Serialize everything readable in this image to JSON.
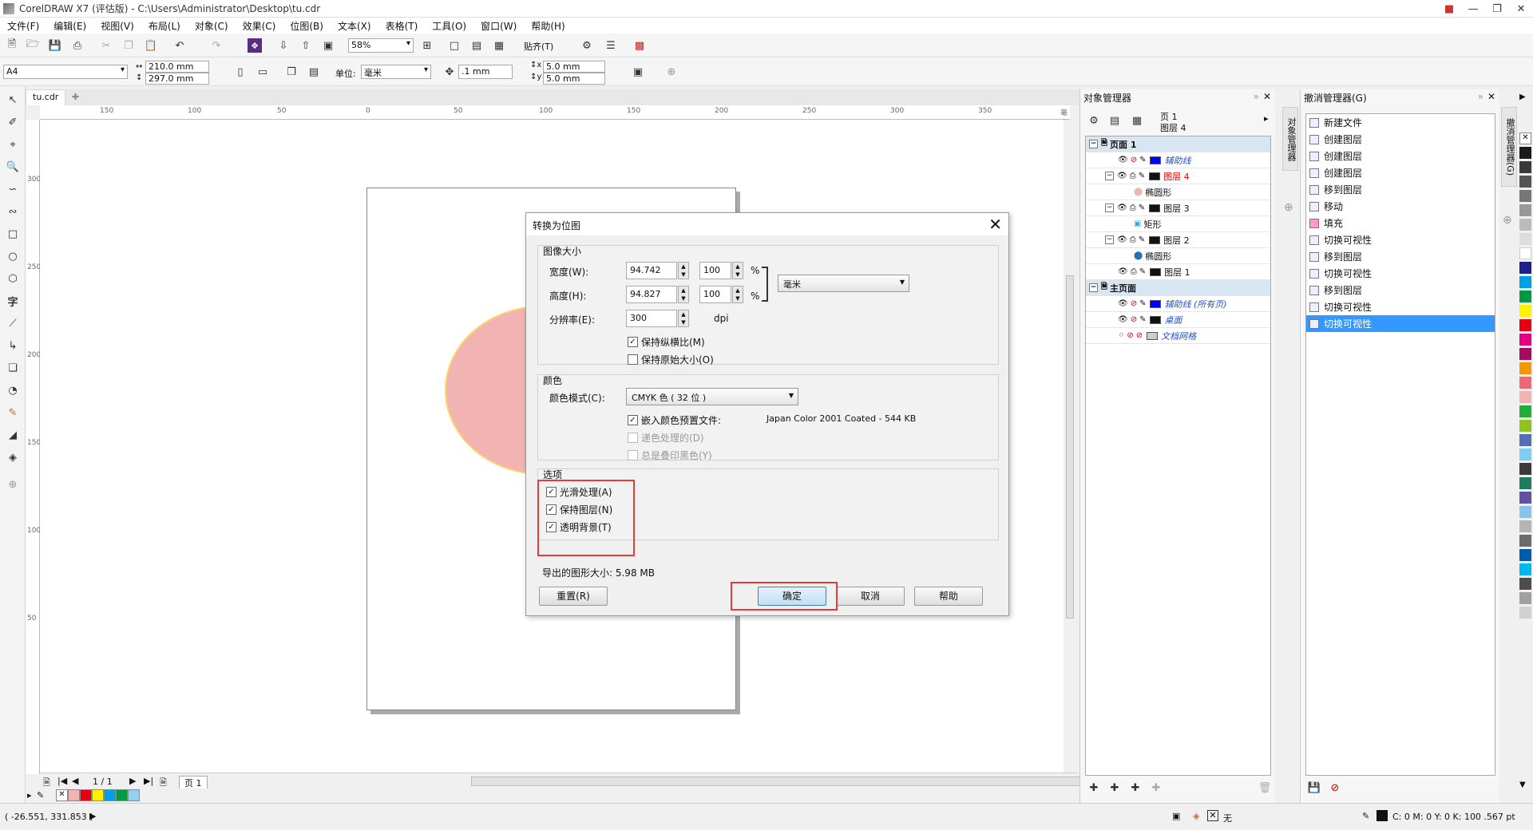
{
  "window": {
    "title": "CorelDRAW X7 (评估版) - C:\\Users\\Administrator\\Desktop\\tu.cdr"
  },
  "menu": [
    "文件(F)",
    "编辑(E)",
    "视图(V)",
    "布局(L)",
    "对象(C)",
    "效果(C)",
    "位图(B)",
    "文本(X)",
    "表格(T)",
    "工具(O)",
    "窗口(W)",
    "帮助(H)"
  ],
  "toolbar": {
    "zoom": "58%",
    "snap": "贴齐(T)"
  },
  "propbar": {
    "page_size": "A4",
    "width": "210.0 mm",
    "height": "297.0 mm",
    "units_label": "单位:",
    "units": "毫米",
    "nudge": ".1 mm",
    "dup_x": "5.0 mm",
    "dup_y": "5.0 mm"
  },
  "doc_tab": "tu.cdr",
  "ruler_h": [
    "150",
    "100",
    "50",
    "0",
    "50",
    "100",
    "150",
    "200",
    "250",
    "300",
    "350"
  ],
  "ruler_unit": "毫米",
  "ruler_v": [
    "300",
    "250",
    "200",
    "150",
    "100",
    "50"
  ],
  "page_nav": {
    "count": "1 / 1",
    "tab": "页 1"
  },
  "status": {
    "coords": "( -26.551, 331.853 )",
    "fill_none": "无",
    "outline": "C: 0 M: 0 Y: 0 K: 100  .567 pt"
  },
  "object_manager": {
    "title": "对象管理器",
    "current_page": "页 1",
    "current_layer": "图层 4",
    "rows": [
      {
        "label": "页面 1",
        "type": "page"
      },
      {
        "label": "辅助线",
        "type": "guide",
        "color": "#0000ff"
      },
      {
        "label": "图层 4",
        "type": "layer-active",
        "color": "#111111"
      },
      {
        "label": "椭圆形",
        "type": "child"
      },
      {
        "label": "图层 3",
        "type": "layer",
        "color": "#111111"
      },
      {
        "label": "矩形",
        "type": "child"
      },
      {
        "label": "图层 2",
        "type": "layer",
        "color": "#111111"
      },
      {
        "label": "椭圆形",
        "type": "child"
      },
      {
        "label": "图层 1",
        "type": "layer",
        "color": "#111111"
      },
      {
        "label": "主页面",
        "type": "page"
      },
      {
        "label": "辅助线 (所有页)",
        "type": "guide",
        "color": "#0000ff"
      },
      {
        "label": "桌面",
        "type": "guide",
        "color": "#111111"
      },
      {
        "label": "文档网格",
        "type": "guide",
        "color": "#cccccc"
      }
    ],
    "vertical_tab": "对象管理器"
  },
  "undo_manager": {
    "title": "撤消管理器(G)",
    "items": [
      "新建文件",
      "创建图层",
      "创建图层",
      "创建图层",
      "移到图层",
      "移动",
      "填充",
      "切换可视性",
      "移到图层",
      "切换可视性",
      "移到图层",
      "切换可视性",
      "切换可视性"
    ],
    "selected_index": 12,
    "vertical_tab": "撤消管理器(G)"
  },
  "dialog": {
    "title": "转换为位图",
    "size_group": "图像大小",
    "width_label": "宽度(W):",
    "width_value": "94.742",
    "width_pct": "100",
    "height_label": "高度(H):",
    "height_value": "94.827",
    "height_pct": "100",
    "pct_sign": "%",
    "unit_value": "毫米",
    "res_label": "分辨率(E):",
    "res_value": "300",
    "res_unit": "dpi",
    "keep_ratio": "保持纵横比(M)",
    "keep_original": "保持原始大小(O)",
    "color_group": "颜色",
    "color_mode_label": "颜色模式(C):",
    "color_mode_value": "CMYK 色 ( 32 位 )",
    "embed_profile": "嵌入颜色预置文件:",
    "profile_name": "Japan Color 2001 Coated - 544 KB",
    "dither": "递色处理的(D)",
    "overprint_black": "总是叠印黑色(Y)",
    "options_group": "选项",
    "anti_alias": "光滑处理(A)",
    "keep_layers": "保持图层(N)",
    "transparent_bg": "透明背景(T)",
    "export_size": "导出的图形大小: 5.98 MB",
    "reset": "重置(R)",
    "ok": "确定",
    "cancel": "取消",
    "help": "帮助"
  },
  "colors": {
    "accent": "#3399ff",
    "highlight_box": "#e23c3c",
    "circle_fill": "#f2b3b3",
    "circle_outline": "#ffd36b"
  }
}
